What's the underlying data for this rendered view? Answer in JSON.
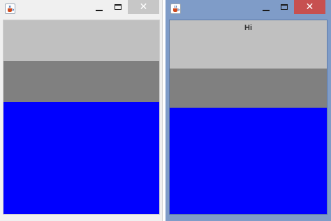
{
  "left_window": {
    "icon": "java-cup-icon",
    "controls": {
      "minimize_icon": "minimize-icon",
      "maximize_icon": "maximize-icon",
      "close_glyph": "✕"
    },
    "panels": [
      {
        "name": "top",
        "color": "#c0c0c0"
      },
      {
        "name": "middle",
        "color": "#808080"
      },
      {
        "name": "bottom",
        "color": "#0000ff"
      }
    ],
    "close_button_color": "#c7c7c7"
  },
  "right_window": {
    "icon": "java-cup-icon",
    "controls": {
      "minimize_icon": "minimize-icon",
      "maximize_icon": "maximize-icon",
      "close_glyph": "✕"
    },
    "top_panel_label": "Hi",
    "panels": [
      {
        "name": "top",
        "color": "#c0c0c0"
      },
      {
        "name": "middle",
        "color": "#808080"
      },
      {
        "name": "bottom",
        "color": "#0000ff"
      }
    ],
    "frame_color": "#7f9cc8",
    "close_button_color": "#c75050"
  }
}
